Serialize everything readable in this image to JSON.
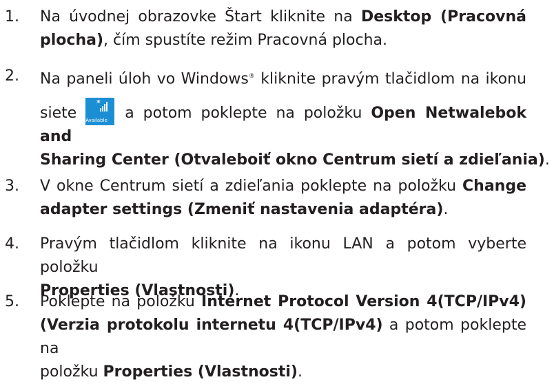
{
  "steps": [
    {
      "num": "1.",
      "l1a": "Na úvodnej obrazovke Štart kliknite na ",
      "l1b": "Desktop (Pracovná",
      "l2a": "plocha)",
      "l2b": ", čím spustíte režim Pracovná plocha."
    },
    {
      "num": "2.",
      "l1a": "Na paneli úloh vo Windows",
      "sup": "®",
      "l1b": " kliknite pravým tlačidlom na ikonu",
      "l2a": "siete ",
      "icon_label": "Available",
      "l2b": " a potom poklepte na položku ",
      "l2c": "Open Netwalebok and",
      "l3a": "Sharing Center (Otvaleboiť okno Centrum sietí a zdieľania)",
      "l3b": "."
    },
    {
      "num": "3.",
      "l1a": "V okne Centrum sietí a zdieľania poklepte na položku ",
      "l1b": "Change",
      "l2a": "adapter settings (Zmeniť nastavenia adaptéra)",
      "l2b": "."
    },
    {
      "num": "4.",
      "l1a": "Pravým tlačidlom kliknite na ikonu LAN a potom vyberte položku",
      "l2a": "Properties (Vlastnosti)",
      "l2b": "."
    },
    {
      "num": "5.",
      "l1a": "Poklepte na položku ",
      "l1b": "Internet Protocol Version 4(TCP/IPv4)",
      "l2a": "(Verzia protokolu internetu 4(TCP/IPv4)",
      "l2b": " a potom poklepte na",
      "l3a": "položku ",
      "l3b": "Properties (Vlastnosti)",
      "l3c": "."
    }
  ],
  "colors": {
    "icon_bg": "#1c8fd4",
    "text": "#231f20"
  },
  "icons": {
    "network": "wifi-signal-icon"
  }
}
